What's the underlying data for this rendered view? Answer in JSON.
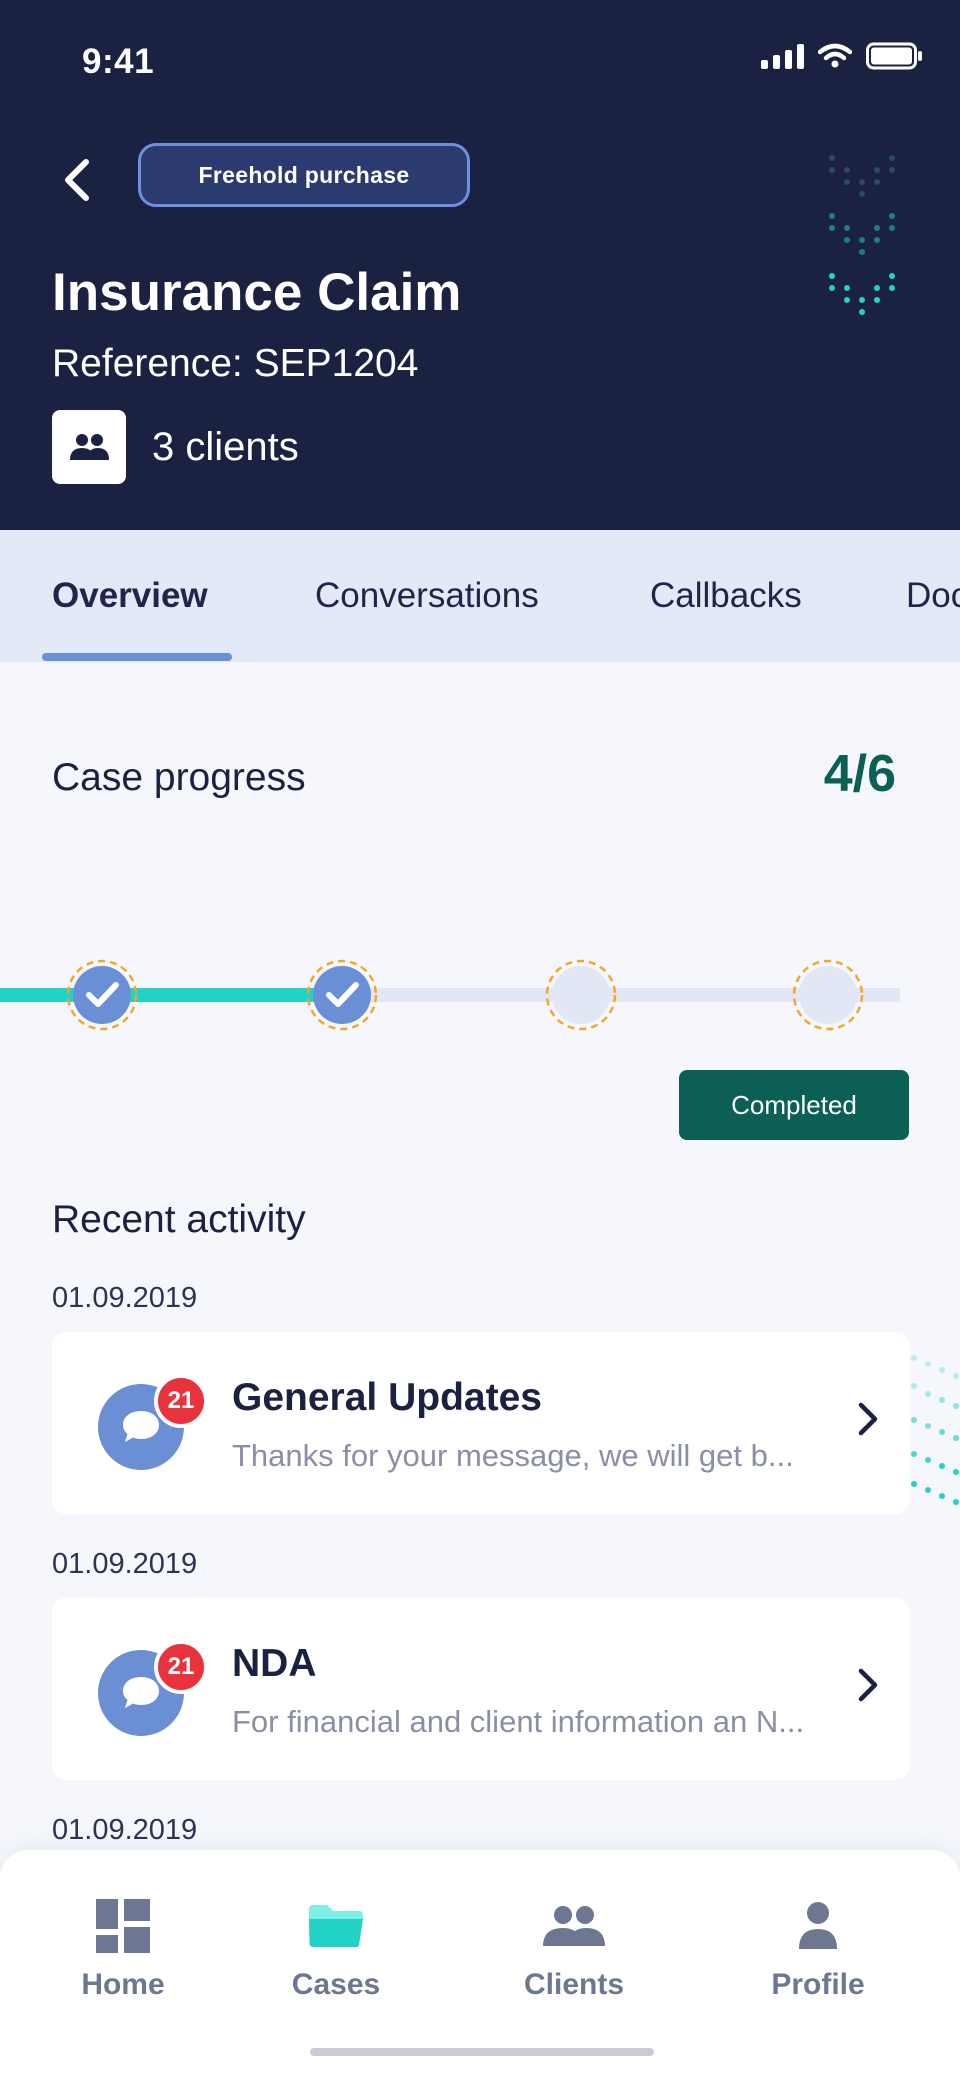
{
  "status_bar": {
    "time": "9:41"
  },
  "header": {
    "purchase_type": "Freehold purchase",
    "title": "Insurance Claim",
    "reference": "Reference: SEP1204",
    "clients_count": "3 clients"
  },
  "tabs": [
    {
      "label": "Overview",
      "active": true
    },
    {
      "label": "Conversations",
      "active": false
    },
    {
      "label": "Callbacks",
      "active": false
    },
    {
      "label": "Documents",
      "active": false
    }
  ],
  "progress": {
    "title": "Case progress",
    "count": "4/6",
    "completed_steps": 2,
    "visible_steps": 4,
    "status_button": "Completed"
  },
  "recent_activity": {
    "title": "Recent activity",
    "items": [
      {
        "date": "01.09.2019",
        "title": "General Updates",
        "preview": "Thanks for your message, we will get b...",
        "badge": "21"
      },
      {
        "date": "01.09.2019",
        "title": "NDA",
        "preview": "For financial and client information an N...",
        "badge": "21"
      },
      {
        "date": "01.09.2019"
      }
    ]
  },
  "bottom_nav": {
    "items": [
      {
        "label": "Home",
        "icon": "home-grid-icon",
        "active": false
      },
      {
        "label": "Cases",
        "icon": "folder-icon",
        "active": true
      },
      {
        "label": "Clients",
        "icon": "people-icon",
        "active": false
      },
      {
        "label": "Profile",
        "icon": "person-icon",
        "active": false
      }
    ]
  },
  "colors": {
    "header_bg": "#1b2140",
    "accent_teal": "#22d3c5",
    "completed_green": "#0b5f55",
    "badge_red": "#e8323c",
    "step_blue": "#6a8fd4"
  }
}
